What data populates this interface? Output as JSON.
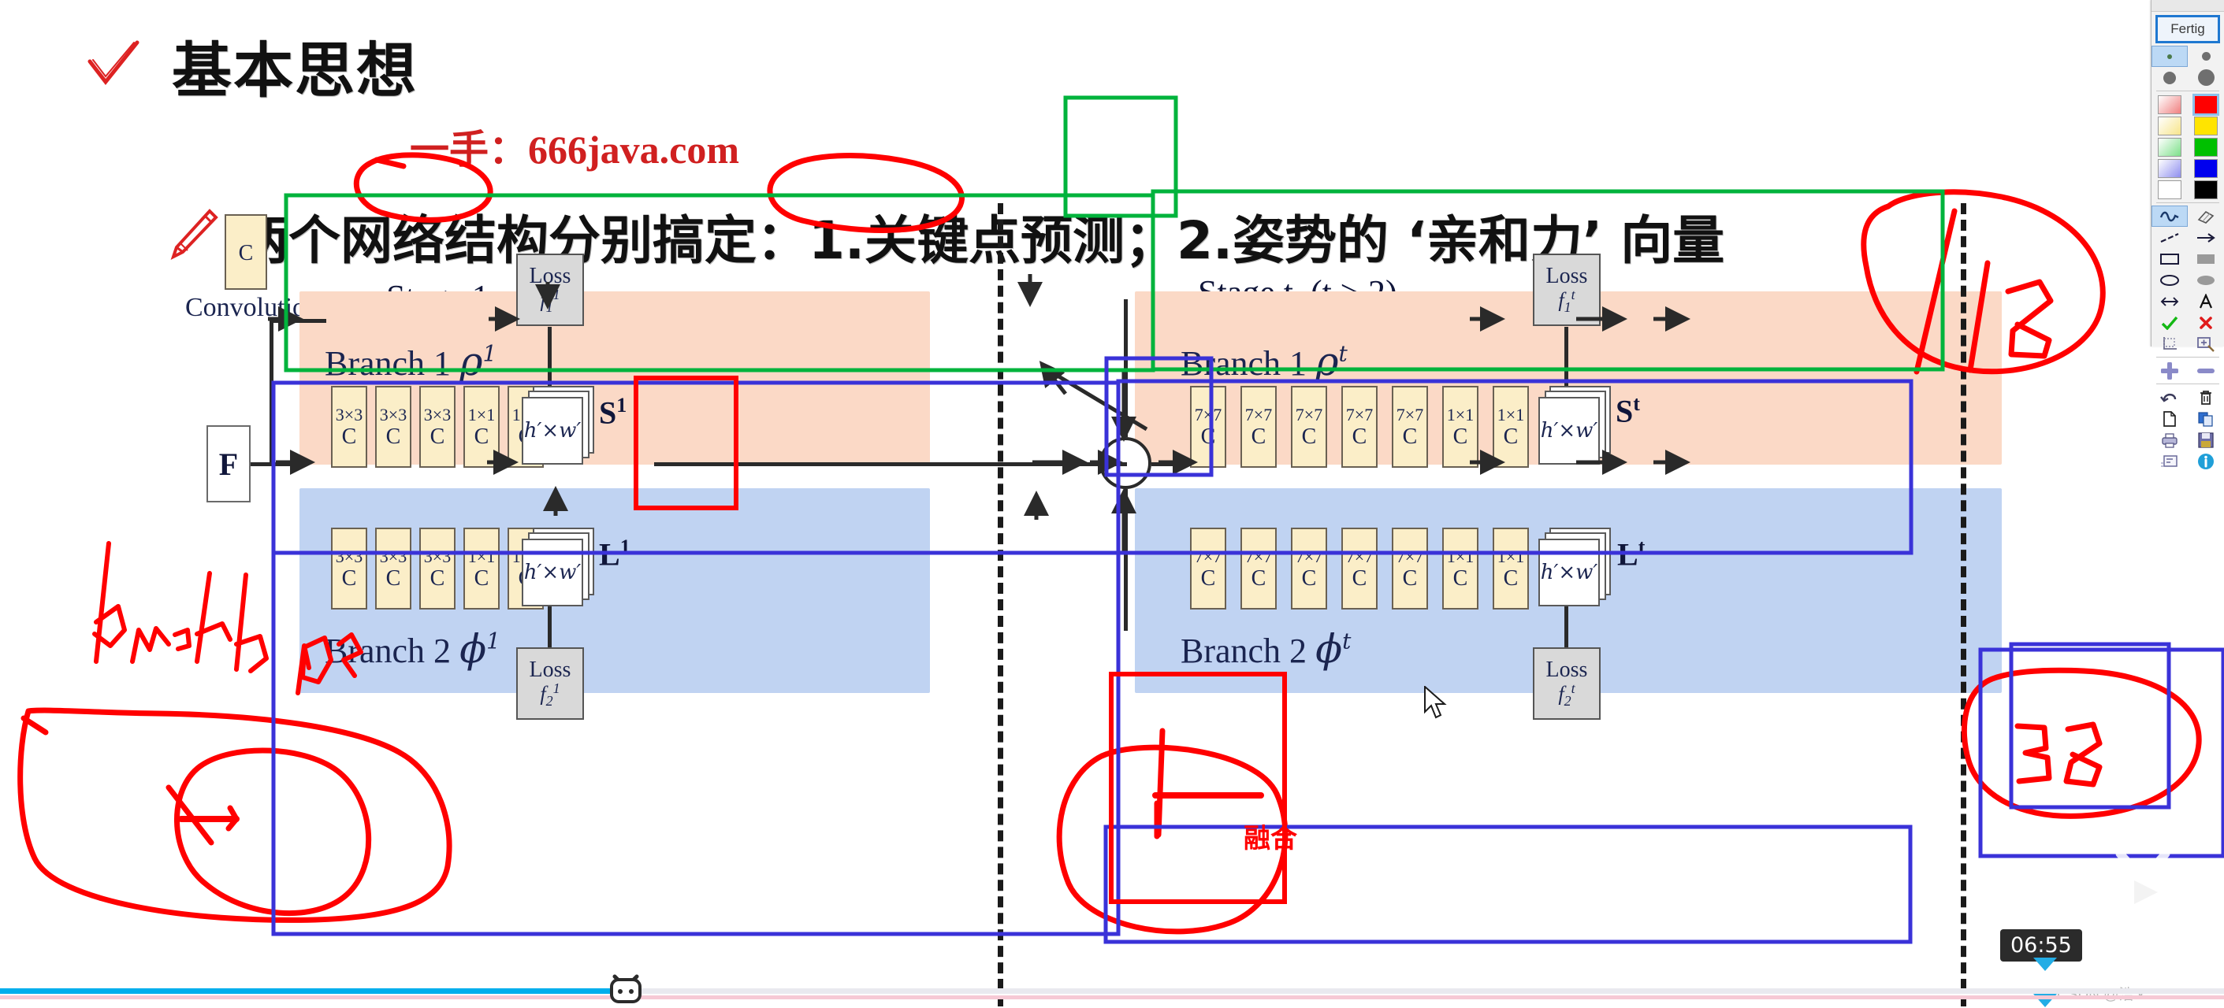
{
  "slide": {
    "check_icon": "check-mark-icon",
    "title": "基本思想",
    "subtitle": "一手：666java.com",
    "pen_icon": "pencil-icon",
    "bullet_line": "两个网络结构分别搞定：1.关键点预测；2.姿势的 ‘亲和力’ 向量"
  },
  "figure": {
    "legend": {
      "box_letter": "C",
      "caption": "Convolution"
    },
    "input_label": "F",
    "stage1": {
      "title": "Stage 1",
      "branch1": {
        "name": "Branch 1",
        "symbol": "ρ",
        "superscript": "1",
        "conv_kernels": [
          "3×3",
          "3×3",
          "3×3",
          "1×1",
          "1×1"
        ],
        "conv_letter": "C",
        "loss_label": "Loss",
        "loss_symbol": "f",
        "loss_sub": "1",
        "loss_sup": "1",
        "featuremap": "h′×w′",
        "output": "S",
        "output_sup": "1"
      },
      "branch2": {
        "name": "Branch 2",
        "symbol": "φ",
        "superscript": "1",
        "conv_kernels": [
          "3×3",
          "3×3",
          "3×3",
          "1×1",
          "1×1"
        ],
        "conv_letter": "C",
        "loss_label": "Loss",
        "loss_symbol": "f",
        "loss_sub": "2",
        "loss_sup": "1",
        "featuremap": "h′×w′",
        "output": "L",
        "output_sup": "1"
      }
    },
    "stage_t": {
      "title": "Stage t, (t ≥ 2)",
      "branch1": {
        "name": "Branch 1",
        "symbol": "ρ",
        "superscript": "t",
        "conv_kernels": [
          "7×7",
          "7×7",
          "7×7",
          "7×7",
          "7×7",
          "1×1",
          "1×1"
        ],
        "conv_letter": "C",
        "loss_label": "Loss",
        "loss_symbol": "f",
        "loss_sub": "1",
        "loss_sup": "t",
        "featuremap": "h′×w′",
        "output": "S",
        "output_sup": "t"
      },
      "branch2": {
        "name": "Branch 2",
        "symbol": "φ",
        "superscript": "t",
        "conv_kernels": [
          "7×7",
          "7×7",
          "7×7",
          "7×7",
          "7×7",
          "1×1",
          "1×1"
        ],
        "conv_letter": "C",
        "loss_label": "Loss",
        "loss_symbol": "f",
        "loss_sub": "2",
        "loss_sup": "t",
        "featuremap": "h′×w′",
        "output": "L",
        "output_sup": "t"
      }
    }
  },
  "annotations": {
    "fusion_label": "融合",
    "ink_color": "#ff0000",
    "green_box_color": "#00b33c",
    "blue_box_color": "#3a32d8",
    "red_box_color": "#ff0000",
    "handwritten": [
      "branch are",
      "18",
      "38"
    ]
  },
  "toolbar": {
    "done_label": "Fertig",
    "pen_sizes": [
      "size-xs",
      "size-s",
      "size-m",
      "size-l"
    ],
    "colors": [
      "#f08080",
      "#ff0000",
      "#f7e58a",
      "#ffe400",
      "#7de08a",
      "#00c000",
      "#8f8fef",
      "#0000ee",
      "#ffffff",
      "#000000"
    ],
    "selected_color": "#ff0000",
    "tools": [
      "freehand-icon",
      "eraser-icon",
      "line-icon",
      "arrow-icon",
      "rectangle-outline-icon",
      "rectangle-filled-icon",
      "ellipse-outline-icon",
      "ellipse-filled-icon",
      "resize-icon",
      "text-icon",
      "accept-check-icon",
      "reject-cross-icon",
      "crop-icon",
      "zoom-in-icon",
      "plus-icon",
      "minus-icon",
      "undo-icon",
      "trash-icon",
      "new-page-icon",
      "copy-icon",
      "print-icon",
      "save-icon",
      "note-icon",
      "info-icon"
    ],
    "selected_tool": "freehand-icon"
  },
  "player": {
    "timestamp": "06:55",
    "watermark": "CSDN @浩 k",
    "logo": "bilibili-tv-logo",
    "progress_percent": 28
  }
}
